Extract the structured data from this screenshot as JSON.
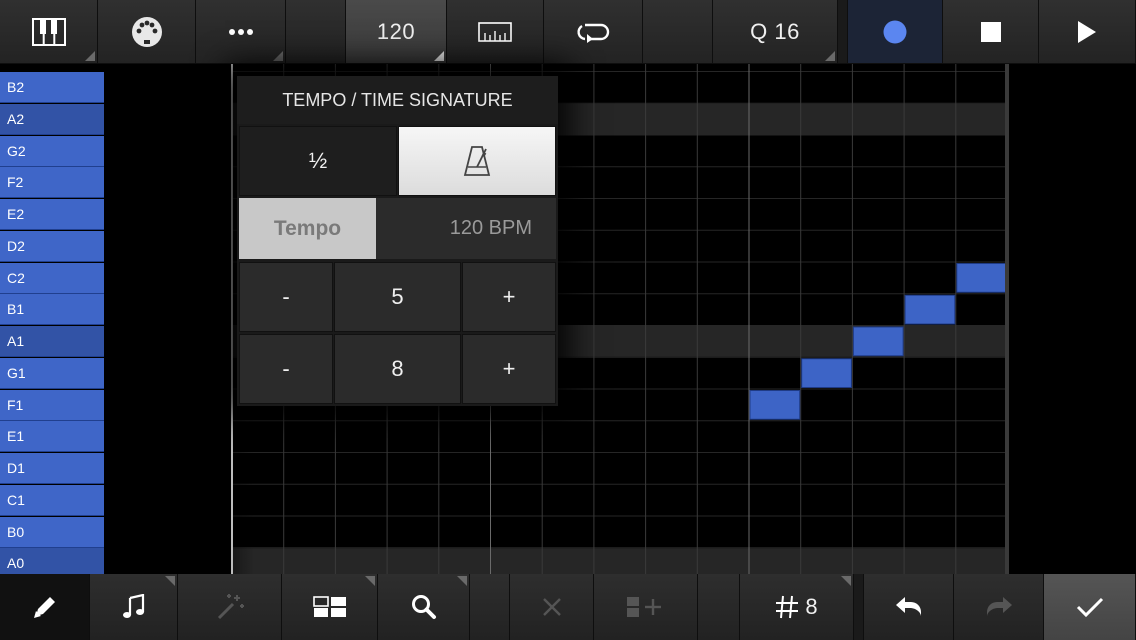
{
  "topbar": {
    "tempo_label": "120",
    "quantize_label": "Q 16",
    "icons": [
      "piano-icon",
      "midi-icon",
      "more-icon",
      "ruler-icon",
      "loop-icon",
      "record-icon",
      "stop-icon",
      "play-icon"
    ]
  },
  "keys": [
    "B2",
    "A2",
    "G2",
    "F2",
    "E2",
    "D2",
    "C2",
    "B1",
    "A1",
    "G1",
    "F1",
    "E1",
    "D1",
    "C1",
    "B0",
    "A0"
  ],
  "popup": {
    "title": "TEMPO / TIME SIGNATURE",
    "half_label": "½",
    "tempo_label": "Tempo",
    "tempo_value": "120 BPM",
    "numerator": {
      "minus": "-",
      "value": "5",
      "plus": "+"
    },
    "denominator": {
      "minus": "-",
      "value": "8",
      "plus": "+"
    }
  },
  "bottombar": {
    "grid_label": "8",
    "icons": [
      "pencil-icon",
      "note-icon",
      "magic-wand-icon",
      "layout-icon",
      "search-icon",
      "delete-icon",
      "add-track-icon",
      "grid-hash-icon",
      "undo-icon",
      "redo-icon",
      "check-icon"
    ]
  },
  "colors": {
    "accent": "#4b6fd6",
    "key_blue": "#3f66c8",
    "note_blue": "#3d64c6",
    "record_dot": "#5b86f0"
  }
}
